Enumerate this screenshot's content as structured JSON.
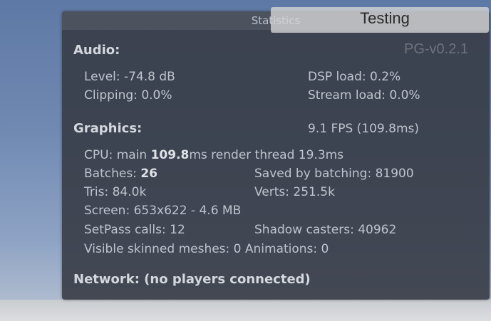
{
  "overlay": {
    "testing_label": "Testing",
    "version": "PG-v0.2.1"
  },
  "stats": {
    "title": "Statistics",
    "audio": {
      "heading": "Audio:",
      "level": "Level: -74.8 dB",
      "dsp_load": "DSP load: 0.2%",
      "clipping": "Clipping: 0.0%",
      "stream_load": "Stream load: 0.0%"
    },
    "graphics": {
      "heading": "Graphics:",
      "fps": "9.1 FPS (109.8ms)",
      "cpu_prefix": "CPU: main ",
      "cpu_main": "109.8",
      "cpu_suffix": "ms  render thread 19.3ms",
      "batches_prefix": "Batches: ",
      "batches": "26",
      "saved_by_batching": "Saved by batching: 81900",
      "tris": "Tris: 84.0k",
      "verts": "Verts: 251.5k",
      "screen": "Screen: 653x622 - 4.6 MB",
      "setpass": "SetPass calls: 12",
      "shadow_casters": "Shadow casters: 40962",
      "skinned": "Visible skinned meshes: 0  Animations: 0"
    },
    "network": {
      "heading": "Network: (no players connected)"
    }
  }
}
